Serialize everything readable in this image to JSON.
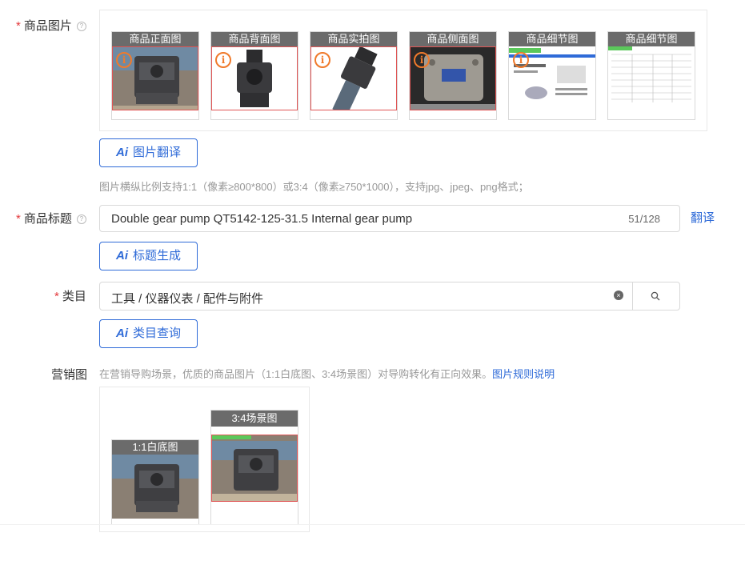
{
  "product_images": {
    "label": "商品图片",
    "help": "?",
    "thumbs": [
      {
        "caption": "商品正面图"
      },
      {
        "caption": "商品背面图"
      },
      {
        "caption": "商品实拍图"
      },
      {
        "caption": "商品侧面图"
      },
      {
        "caption": "商品细节图"
      },
      {
        "caption": "商品细节图"
      }
    ],
    "translate_button": "图片翻译",
    "hint": "图片横纵比例支持1:1（像素≥800*800）或3:4（像素≥750*1000），支持jpg、jpeg、png格式；"
  },
  "title": {
    "label": "商品标题",
    "help": "?",
    "value": "Double gear pump QT5142-125-31.5 Internal gear pump",
    "count": "51/128",
    "translate_link": "翻译",
    "generate_button": "标题生成"
  },
  "category": {
    "label": "类目",
    "value": "工具 / 仪器仪表 / 配件与附件",
    "query_button": "类目查询"
  },
  "marketing": {
    "label": "营销图",
    "hint": "在营销导购场景，优质的商品图片（1:1白底图、3:4场景图）对导购转化有正向效果。",
    "rules_link": "图片规则说明",
    "images": [
      {
        "caption": "1:1白底图"
      },
      {
        "caption": "3:4场景图"
      }
    ]
  },
  "ai_label": "Ai",
  "warn_symbol": "i",
  "colors": {
    "accent": "#2f6bd8",
    "required": "#e4393c",
    "warning": "#f07a2b",
    "caption_bg": "#6b6b6b"
  }
}
